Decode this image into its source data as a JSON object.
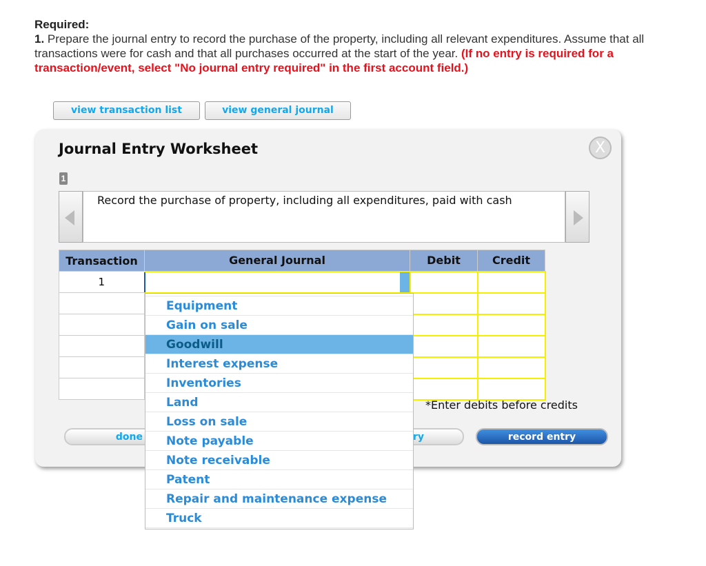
{
  "instructions": {
    "heading": "Required:",
    "number": "1.",
    "text": " Prepare the journal entry to record the purchase of the property, including all relevant expenditures. Assume that all transactions were for cash and that all purchases occurred at the start of the year. ",
    "note": "(If no entry is required for a transaction/event, select \"No journal entry required\" in the first account field.)"
  },
  "buttons": {
    "view_transaction_list": "view transaction list",
    "view_general_journal": "view general journal",
    "done": "done",
    "clear_entry": "clear entry",
    "record_entry": "record entry"
  },
  "worksheet": {
    "title": "Journal Entry Worksheet",
    "close": "X",
    "page": "1",
    "description": "Record the purchase of property, including all expenditures, paid with cash",
    "note": "*Enter debits before credits"
  },
  "table": {
    "headers": [
      "Transaction",
      "General Journal",
      "Debit",
      "Credit"
    ],
    "rows": [
      [
        "1",
        "",
        "",
        ""
      ],
      [
        "",
        "",
        "",
        ""
      ],
      [
        "",
        "",
        "",
        ""
      ],
      [
        "",
        "",
        "",
        ""
      ],
      [
        "",
        "",
        "",
        ""
      ],
      [
        "",
        "",
        "",
        ""
      ]
    ]
  },
  "dropdown": {
    "selected": "Goodwill",
    "options": [
      "Equipment",
      "Gain on sale",
      "Goodwill",
      "Interest expense",
      "Inventories",
      "Land",
      "Loss on sale",
      "Note payable",
      "Note receivable",
      "Patent",
      "Repair and maintenance expense",
      "Truck"
    ]
  }
}
